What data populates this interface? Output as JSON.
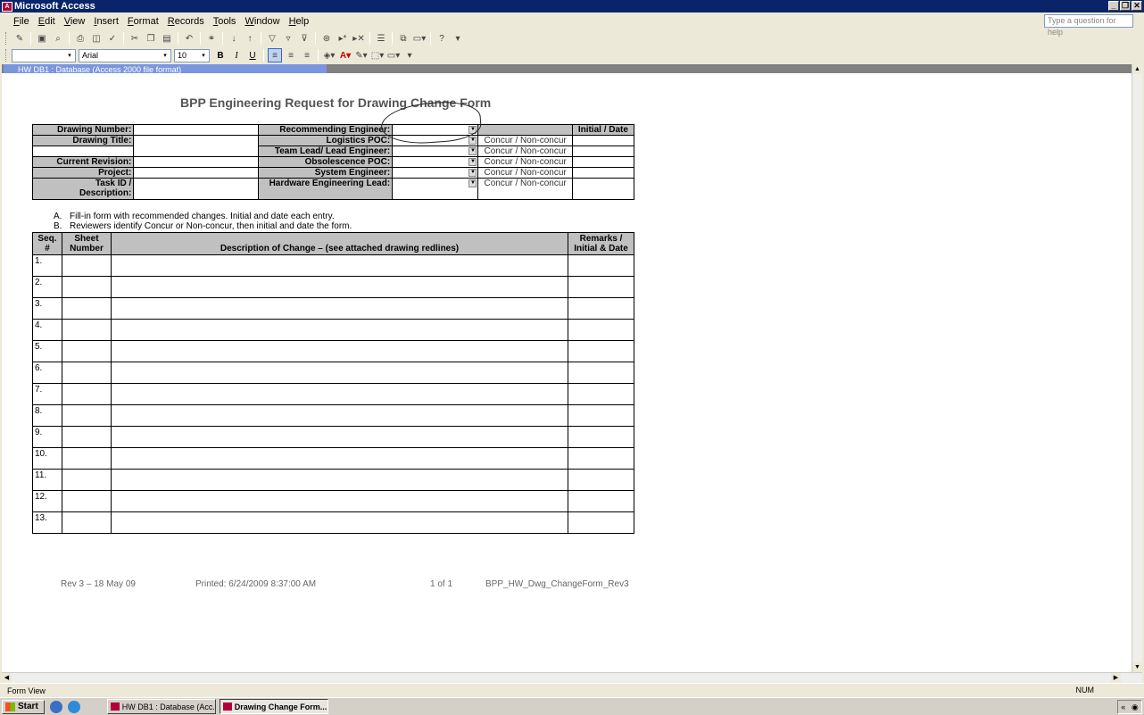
{
  "window": {
    "title": "Microsoft Access",
    "app_icon": "access-icon"
  },
  "menu": [
    "File",
    "Edit",
    "View",
    "Insert",
    "Format",
    "Records",
    "Tools",
    "Window",
    "Help"
  ],
  "help_box": {
    "placeholder": "Type a question for help"
  },
  "toolbar2": {
    "font": "Arial",
    "size": "10",
    "bold": "B",
    "italic": "I",
    "underline": "U"
  },
  "mdi": {
    "title": "HW DB1 : Database (Access 2000 file format)"
  },
  "form": {
    "title": "BPP Engineering Request for Drawing Change Form",
    "left_fields": {
      "drawing_number": "Drawing Number:",
      "drawing_title": "Drawing Title:",
      "current_revision": "Current Revision:",
      "project": "Project:",
      "task_id": "Task ID /",
      "description": "Description:"
    },
    "reviewers": [
      "Recommending Engineer:",
      "Logistics POC:",
      "Team Lead/ Lead Engineer:",
      "Obsolescence POC:",
      "System Engineer:",
      "Hardware Engineering Lead:"
    ],
    "concur_text": "Concur / Non-concur",
    "initial_date_header": "Initial / Date",
    "instructions": [
      {
        "letter": "A.",
        "text": "Fill-in form with recommended changes.  Initial and date each entry."
      },
      {
        "letter": "B.",
        "text": "Reviewers identify Concur or Non-concur, then initial and date the form."
      }
    ],
    "table_headers": {
      "seq": "Seq. #",
      "sheet": "Sheet Number",
      "desc": "Description of Change – (see attached drawing redlines)",
      "remarks": "Remarks / Initial & Date"
    },
    "rows": [
      "1.",
      "2.",
      "3.",
      "4.",
      "5.",
      "6.",
      "7.",
      "8.",
      "9.",
      "10.",
      "11.",
      "12.",
      "13."
    ],
    "footer": {
      "rev": "Rev 3 – 18 May 09",
      "printed": "Printed: 6/24/2009 8:37:00 AM",
      "page": "1 of 1",
      "name": "BPP_HW_Dwg_ChangeForm_Rev3"
    }
  },
  "status": {
    "mode": "Form View",
    "num": "NUM"
  },
  "taskbar": {
    "start": "Start",
    "items": [
      "HW DB1 : Database (Acc...",
      "Drawing Change Form..."
    ]
  }
}
